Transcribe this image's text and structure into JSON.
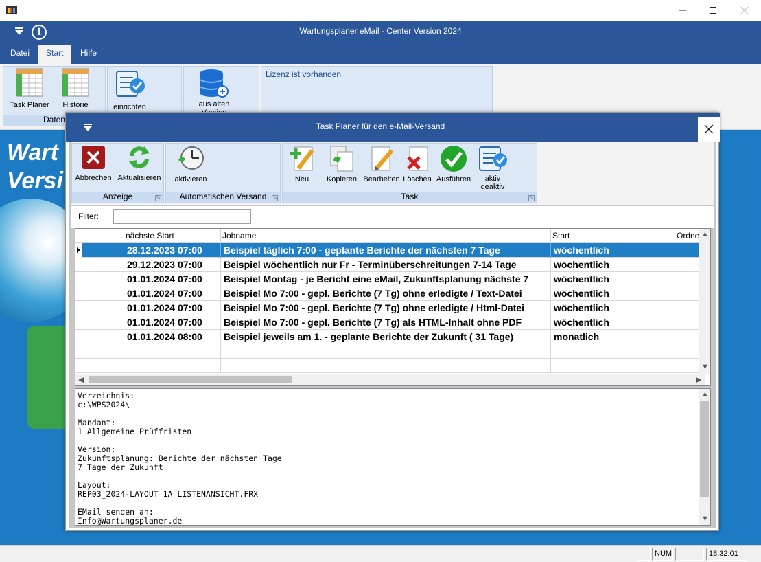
{
  "app": {
    "title": "Wartungsplaner eMail - Center Version 2024",
    "menu": [
      "Datei",
      "Start",
      "Hilfe"
    ],
    "active_menu": "Start"
  },
  "ribbon": {
    "task_planer": "Task Planer",
    "historie": "Historie",
    "einrichten": "einrichten",
    "aus_alten_version": "aus alten\nVersion",
    "group_daten": "Daten",
    "lizenz": "Lizenz ist vorhanden"
  },
  "background": {
    "line1": "Wart",
    "line2": "Versi"
  },
  "dialog": {
    "title": "Task Planer für den e-Mail-Versand",
    "buttons": {
      "abbrechen": "Abbrechen",
      "aktualisieren": "Aktualisieren",
      "aktivieren": "aktivieren",
      "neu": "Neu",
      "kopieren": "Kopieren",
      "bearbeiten": "Bearbeiten",
      "loeschen": "Löschen",
      "ausfuehren": "Ausführen",
      "aktiv_deaktiv": "aktiv\ndeaktiv"
    },
    "groups": {
      "anzeige": "Anzeige",
      "automatischen_versand": "Automatischen Versand",
      "task": "Task"
    },
    "filter": {
      "label": "Filter:",
      "value": ""
    },
    "grid": {
      "columns": [
        "nächste Start",
        "Jobname",
        "Start",
        "Ordner"
      ],
      "rows": [
        {
          "next": "28.12.2023 07:00",
          "job": "Beispiel täglich 7:00 - geplante Berichte der nächsten 7 Tage",
          "start": "wöchentlich",
          "ordner": ""
        },
        {
          "next": "29.12.2023 07:00",
          "job": "Beispiel wöchentlich nur Fr - Terminüberschreitungen 7-14 Tage",
          "start": "wöchentlich",
          "ordner": ""
        },
        {
          "next": "01.01.2024 07:00",
          "job": "Beispiel Montag - je Bericht eine eMail, Zukunftsplanung nächste 7",
          "start": "wöchentlich",
          "ordner": ""
        },
        {
          "next": "01.01.2024 07:00",
          "job": "Beispiel Mo 7:00 - gepl. Berichte (7 Tg)  ohne erledigte / Text-Datei",
          "start": "wöchentlich",
          "ordner": ""
        },
        {
          "next": "01.01.2024 07:00",
          "job": "Beispiel Mo 7:00 - gepl. Berichte (7 Tg)  ohne erledigte / Html-Datei",
          "start": "wöchentlich",
          "ordner": ""
        },
        {
          "next": "01.01.2024 07:00",
          "job": "Beispiel Mo 7:00 - gepl. Berichte (7 Tg)  als HTML-Inhalt ohne PDF",
          "start": "wöchentlich",
          "ordner": ""
        },
        {
          "next": "01.01.2024 08:00",
          "job": "Beispiel jeweils am 1. - geplante Berichte der Zukunft ( 31 Tage)",
          "start": "monatlich",
          "ordner": ""
        }
      ]
    },
    "details": "Verzeichnis:\nc:\\WPS2024\\\n\nMandant:\n1 Allgemeine Prüffristen\n\nVersion:\nZukunftsplanung: Berichte der nächsten Tage\n7 Tage der Zukunft\n\nLayout:\nREP03_2024-LAYOUT 1A LISTENANSICHT.FRX\n\nEMail senden an:\nInfo@Wartungsplaner.de"
  },
  "statusbar": {
    "num": "NUM",
    "time": "18:32:01"
  },
  "colors": {
    "header_blue": "#2b579a",
    "background_blue": "#1d7bc3",
    "selected_row": "#1e7fc6"
  }
}
